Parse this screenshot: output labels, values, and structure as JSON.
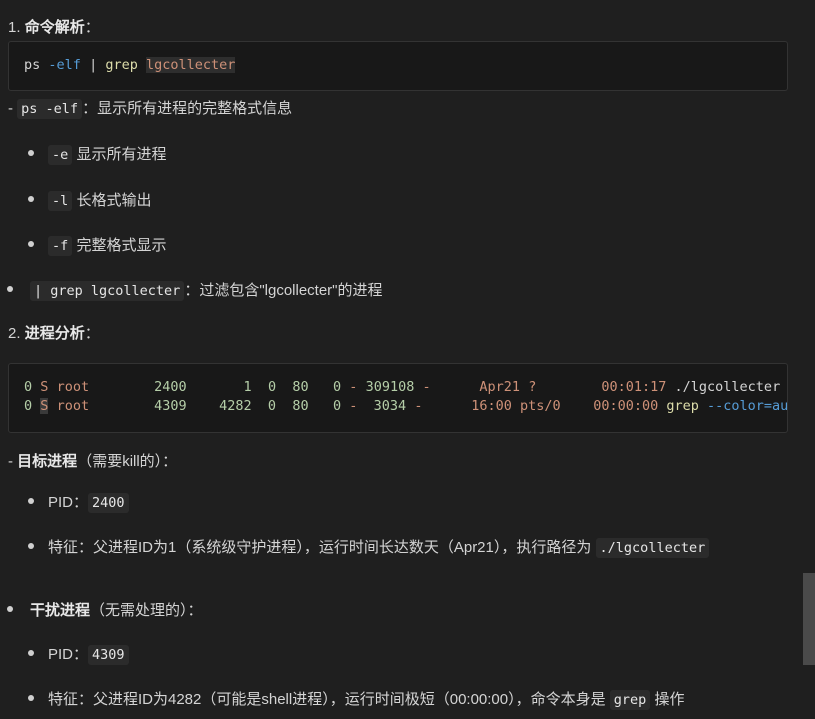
{
  "section1": {
    "number": "1.",
    "title": "命令解析",
    "colon": "：",
    "command": {
      "ps": "ps",
      "flag": "-elf",
      "pipe": "|",
      "grep": "grep",
      "target": "lgcollecter"
    }
  },
  "explain": {
    "dash": "-",
    "ps_code": "ps -elf",
    "ps_desc": "：显示所有进程的完整格式信息",
    "flags": [
      {
        "code": "-e",
        "desc": "显示所有进程"
      },
      {
        "code": "-l",
        "desc": "长格式输出"
      },
      {
        "code": "-f",
        "desc": "完整格式显示"
      }
    ],
    "grep_code": "| grep lgcollecter",
    "grep_desc": "：过滤包含\"lgcollecter\"的进程"
  },
  "section2": {
    "number": "2.",
    "title": "进程分析",
    "colon": "：",
    "rows": [
      {
        "f": "0",
        "s": "S",
        "user": "root",
        "pid": "2400",
        "ppid": "1",
        "c": "0",
        "pri": "80",
        "ni": "0",
        "addr": "-",
        "sz": "309108",
        "wchan": "-",
        "stime": "Apr21",
        "tty": "?",
        "time": "00:01:17",
        "cmd": "./lgcollecter",
        "cmd_opt": ""
      },
      {
        "f": "0",
        "s": "S",
        "user": "root",
        "pid": "4309",
        "ppid": "4282",
        "c": "0",
        "pri": "80",
        "ni": "0",
        "addr": "-",
        "sz": "3034",
        "wchan": "-",
        "stime": "16:00",
        "tty": "pts/0",
        "time": "00:00:00",
        "cmd": "grep",
        "cmd_opt": "--color=aut"
      }
    ]
  },
  "target": {
    "dash": "-",
    "title": "目标进程",
    "note": "（需要kill的）：",
    "pid_label": "PID：",
    "pid": "2400",
    "feature_label": "特征：父进程ID为1（系统级守护进程），运行时间长达数天（Apr21），执行路径为",
    "feature_path": "./lgcollecter"
  },
  "noise": {
    "title": "干扰进程",
    "note": "（无需处理的）：",
    "pid_label": "PID：",
    "pid": "4309",
    "feature_label": "特征：父进程ID为4282（可能是shell进程），运行时间极短（00:00:00），命令本身是",
    "feature_code": "grep",
    "feature_suffix": "操作"
  }
}
